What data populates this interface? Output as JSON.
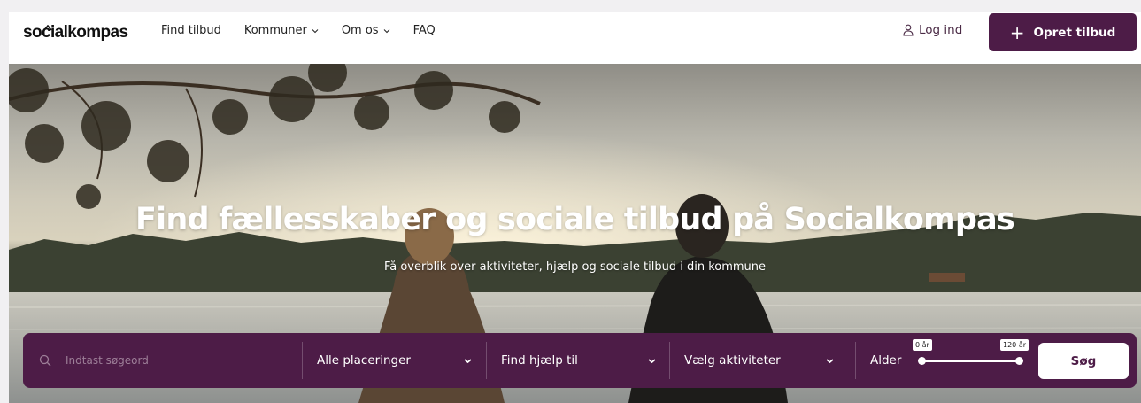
{
  "brand": {
    "logo_text": "socialkompas",
    "accent": "#4d1c47"
  },
  "nav": {
    "items": [
      {
        "label": "Find tilbud",
        "dropdown": false
      },
      {
        "label": "Kommuner",
        "dropdown": true
      },
      {
        "label": "Om os",
        "dropdown": true
      },
      {
        "label": "FAQ",
        "dropdown": false
      }
    ],
    "login_label": "Log ind",
    "login_icon": "user-icon",
    "cta_label": "Opret tilbud",
    "cta_icon": "plus-icon"
  },
  "hero": {
    "title": "Find fællesskaber og sociale tilbud på Socialkompas",
    "subtitle": "Få overblik over aktiviteter, hjælp og sociale tilbud i din kommune"
  },
  "search": {
    "placeholder": "Indtast søgeord",
    "search_icon": "search-icon",
    "location_label": "Alle placeringer",
    "help_label": "Find hjælp til",
    "activities_label": "Vælg aktiviteter",
    "age_label": "Alder",
    "age_min": "0 år",
    "age_max": "120 år",
    "age_range_fraction": [
      0,
      1
    ],
    "submit_label": "Søg"
  }
}
